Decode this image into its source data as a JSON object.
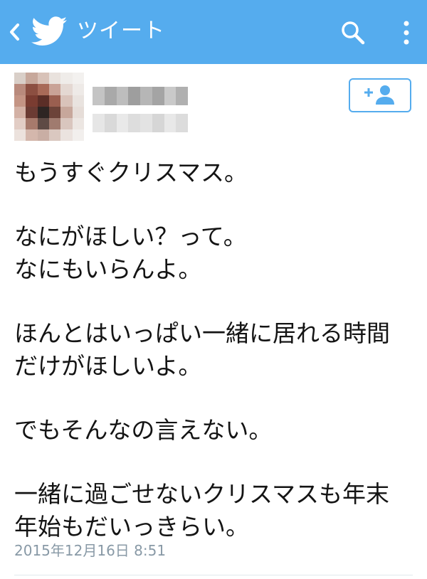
{
  "header": {
    "title": "ツイート",
    "accent_color": "#55acee",
    "back_icon": "chevron-left-icon",
    "logo_icon": "twitter-bird-icon",
    "search_icon": "search-icon",
    "menu_icon": "more-vertical-icon"
  },
  "author": {
    "avatar_icon": "pixelated-avatar",
    "follow_icon": "add-user-icon"
  },
  "tweet": {
    "lines": [
      "もうすぐクリスマス。",
      "なにがほしい？って。",
      "なにもいらんよ。",
      "ほんとはいっぱい一緒に居れる時間",
      "だけがほしいよ。",
      "でもそんなの言えない。",
      "一緒に過ごせないクリスマスも年末",
      "年始もだいっきらい。"
    ],
    "timestamp": "2015年12月16日 8:51"
  }
}
